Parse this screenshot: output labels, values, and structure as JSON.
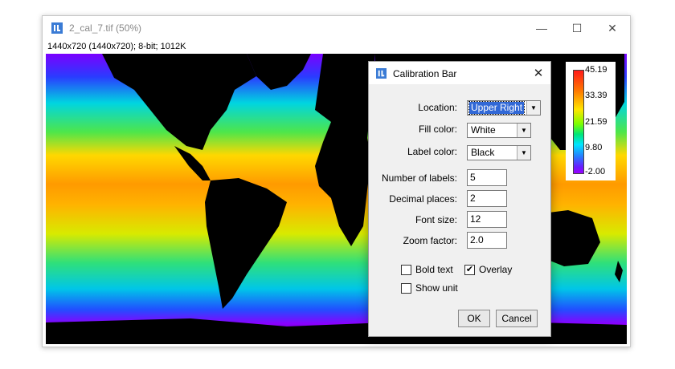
{
  "window": {
    "title": "2_cal_7.tif (50%)",
    "image_info": "1440x720   (1440x720); 8-bit; 1012K",
    "controls": {
      "minimize": "—",
      "maximize": "☐",
      "close": "✕"
    }
  },
  "calibration_bar_overlay": {
    "labels": [
      "45.19",
      "33.39",
      "21.59",
      "9.80",
      "-2.00"
    ]
  },
  "dialog": {
    "title": "Calibration Bar",
    "close": "✕",
    "location": {
      "label": "Location:",
      "value": "Upper Right"
    },
    "fill_color": {
      "label": "Fill color:",
      "value": "White"
    },
    "label_color": {
      "label": "Label color:",
      "value": "Black"
    },
    "number_of_labels": {
      "label": "Number of labels:",
      "value": "5"
    },
    "decimal_places": {
      "label": "Decimal places:",
      "value": "2"
    },
    "font_size": {
      "label": "Font size:",
      "value": "12"
    },
    "zoom_factor": {
      "label": "Zoom factor:",
      "value": "2.0"
    },
    "bold_text": {
      "label": "Bold text",
      "checked": false
    },
    "overlay": {
      "label": "Overlay",
      "checked": true
    },
    "show_unit": {
      "label": "Show unit",
      "checked": false
    },
    "ok": "OK",
    "cancel": "Cancel"
  },
  "icons": {
    "app": "imagej-icon",
    "dropdown": "chevron-down-icon"
  }
}
